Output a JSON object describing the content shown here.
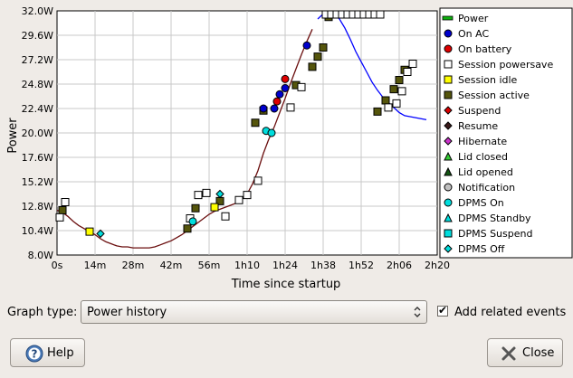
{
  "chart_data": {
    "type": "line",
    "xlabel": "Time since startup",
    "ylabel": "Power",
    "y_ticks": [
      "8.0W",
      "10.4W",
      "12.8W",
      "15.2W",
      "17.6W",
      "20.0W",
      "22.4W",
      "24.8W",
      "27.2W",
      "29.6W",
      "32.0W"
    ],
    "x_ticks": [
      "0s",
      "14m",
      "28m",
      "42m",
      "56m",
      "1h10",
      "1h24",
      "1h38",
      "1h52",
      "2h06",
      "2h20"
    ],
    "ylim": [
      8.0,
      32.0
    ],
    "xlim_minutes": [
      0,
      140
    ],
    "grid": true,
    "legend_position": "right",
    "series": [
      {
        "name": "Power",
        "color": "#0000ff",
        "segment_colors": {
          "on_battery": "#6b0f0f",
          "on_ac": "#0000ff"
        },
        "x": [
          0,
          2,
          4,
          6,
          8,
          10,
          12,
          14,
          16,
          18,
          20,
          22,
          24,
          26,
          28,
          30,
          32,
          34,
          36,
          38,
          40,
          42,
          44,
          46,
          48,
          50,
          52,
          54,
          56,
          58,
          60,
          62,
          64,
          66,
          68,
          70,
          72,
          74,
          76,
          78,
          80,
          82,
          84,
          86,
          88,
          90,
          92,
          94,
          96,
          98,
          100,
          102,
          104,
          106,
          108,
          110,
          112,
          114,
          116,
          118,
          120,
          122,
          124,
          126,
          128,
          130,
          132,
          134,
          136
        ],
        "y": [
          12.4,
          12.2,
          11.8,
          11.3,
          10.9,
          10.6,
          10.3,
          10.0,
          9.6,
          9.3,
          9.1,
          8.9,
          8.8,
          8.8,
          8.7,
          8.7,
          8.7,
          8.7,
          8.8,
          9.0,
          9.2,
          9.4,
          9.7,
          10.0,
          10.4,
          10.8,
          11.2,
          11.6,
          12.0,
          12.3,
          12.5,
          12.7,
          12.9,
          13.1,
          13.5,
          14.0,
          15.0,
          16.3,
          18.0,
          19.4,
          20.6,
          22.0,
          23.4,
          24.9,
          26.3,
          27.7,
          29.0,
          30.2,
          31.2,
          31.7,
          31.9,
          31.7,
          31.2,
          30.3,
          29.2,
          28.0,
          27.0,
          26.0,
          25.0,
          24.2,
          23.5,
          23.0,
          22.5,
          22.0,
          21.7,
          21.6,
          21.5,
          21.4,
          21.3
        ],
        "values_visible_range_note": ""
      }
    ],
    "events": [
      {
        "type": "session_active",
        "x": [
          2,
          48,
          51,
          60,
          73,
          76,
          88,
          94,
          96,
          98,
          100,
          118,
          121,
          124,
          126,
          128
        ],
        "y": [
          12.4,
          10.6,
          12.6,
          13.3,
          21.0,
          22.2,
          24.7,
          26.5,
          27.5,
          28.4,
          31.4,
          22.1,
          23.2,
          24.3,
          25.2,
          26.2
        ]
      },
      {
        "type": "session_powersave",
        "x": [
          1,
          3,
          49,
          52,
          55,
          62,
          67,
          70,
          74,
          86,
          90,
          99,
          101,
          103,
          105,
          107,
          109,
          111,
          113,
          115,
          117,
          119,
          122,
          125,
          127,
          129,
          131
        ],
        "y": [
          11.7,
          13.2,
          11.6,
          13.9,
          14.1,
          11.8,
          13.4,
          13.9,
          15.3,
          22.5,
          24.5,
          31.9,
          32.0,
          32.0,
          32.0,
          32.0,
          32.0,
          32.0,
          32.0,
          32.0,
          32.0,
          32.0,
          22.5,
          22.9,
          24.1,
          26.0,
          26.8
        ]
      },
      {
        "type": "session_idle",
        "x": [
          12,
          58
        ],
        "y": [
          10.3,
          12.7
        ]
      },
      {
        "type": "on_ac",
        "x": [
          76,
          80,
          82,
          84,
          92
        ],
        "y": [
          22.4,
          22.4,
          23.8,
          24.4,
          28.6
        ]
      },
      {
        "type": "on_battery",
        "x": [
          81,
          84
        ],
        "y": [
          23.1,
          25.3
        ]
      },
      {
        "type": "dpms_on",
        "x": [
          50,
          77,
          79
        ],
        "y": [
          11.3,
          20.2,
          20.0
        ]
      },
      {
        "type": "dpms_off",
        "x": [
          16,
          60
        ],
        "y": [
          10.1,
          14.0
        ]
      }
    ],
    "legend": [
      {
        "key": "power",
        "label": "Power",
        "shape": "line",
        "color": "#0db00d"
      },
      {
        "key": "on_ac",
        "label": "On AC",
        "shape": "circle",
        "color": "#0000cc"
      },
      {
        "key": "on_battery",
        "label": "On battery",
        "shape": "circle",
        "color": "#dd0000"
      },
      {
        "key": "session_powersave",
        "label": "Session powersave",
        "shape": "square",
        "color": "#ffffff"
      },
      {
        "key": "session_idle",
        "label": "Session idle",
        "shape": "square",
        "color": "#ffff00"
      },
      {
        "key": "session_active",
        "label": "Session active",
        "shape": "square",
        "color": "#55550c"
      },
      {
        "key": "suspend",
        "label": "Suspend",
        "shape": "diamond",
        "color": "#dd0000"
      },
      {
        "key": "resume",
        "label": "Resume",
        "shape": "diamond",
        "color": "#3a1a1a"
      },
      {
        "key": "hibernate",
        "label": "Hibernate",
        "shape": "diamond",
        "color": "#cc33cc"
      },
      {
        "key": "lid_closed",
        "label": "Lid closed",
        "shape": "triangle",
        "color": "#33cc33"
      },
      {
        "key": "lid_opened",
        "label": "Lid opened",
        "shape": "triangle",
        "color": "#115511"
      },
      {
        "key": "notification",
        "label": "Notification",
        "shape": "circle",
        "color": "#c0c0c0"
      },
      {
        "key": "dpms_on",
        "label": "DPMS On",
        "shape": "circle",
        "color": "#00dddd"
      },
      {
        "key": "dpms_standby",
        "label": "DPMS Standby",
        "shape": "triangle",
        "color": "#00dddd"
      },
      {
        "key": "dpms_suspend",
        "label": "DPMS Suspend",
        "shape": "square",
        "color": "#00dddd"
      },
      {
        "key": "dpms_off",
        "label": "DPMS Off",
        "shape": "diamond",
        "color": "#00dddd"
      }
    ]
  },
  "controls": {
    "graph_type_label": "Graph type:",
    "graph_type_value": "Power history",
    "add_related_events_label": "Add related events",
    "add_related_events_checked": true
  },
  "buttons": {
    "help_label": "Help",
    "close_label": "Close"
  }
}
